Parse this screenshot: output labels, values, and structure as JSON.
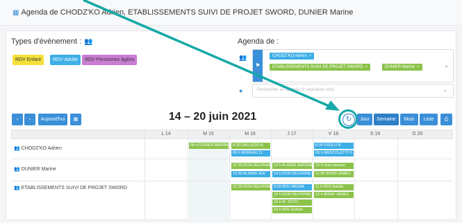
{
  "header": {
    "title": "Agenda de CHODZ'KO Adrien, ETABLISSEMENTS SUIVI DE PROJET SWORD, DUNIER Marine"
  },
  "types": {
    "label": "Types d'évènement :",
    "buttons": [
      {
        "label": "RDV Enfant",
        "color": "#f4e13a"
      },
      {
        "label": "RDV Adulte",
        "color": "#3eaee6"
      },
      {
        "label": "RDV Personnes âgées",
        "color": "#c97dd3"
      }
    ]
  },
  "agenda": {
    "label": "Agenda de :",
    "chips": [
      {
        "label": "CHODZ'KO Adrien",
        "color": "#3eaee6"
      },
      {
        "label": "ETABLISSEMENTS SUIVI DE PROJET SWORD",
        "color": "#8bc34a"
      },
      {
        "label": "DUNIER Marine",
        "color": "#8bc34a"
      }
    ],
    "search_placeholder": "Rechercher un agenda (3 caractères min)"
  },
  "toolbar": {
    "prev": "‹",
    "next": "›",
    "today": "Aujourd'hui",
    "range": "14 – 20 juin 2021",
    "views": [
      "Jour",
      "Semaine",
      "Mois",
      "Liste"
    ]
  },
  "days": [
    "L 14",
    "M 15",
    "M 16",
    "J 17",
    "V 18",
    "S 19",
    "D 20"
  ],
  "rows": [
    {
      "label": "CHODZ'KO Adrien"
    },
    {
      "label": "DUNIER Marine"
    },
    {
      "label": "ETABLISSEMENTS SUIVI DE PROJET SWORD"
    }
  ],
  "events": {
    "r1_m15_1": "09 h DUNIER MARINE",
    "r1_m16_1": "8:30 GALLEGO A.",
    "r1_m16_2": "09 h MOREAU D.",
    "r1_v18_1": "8:30 FROLU R.",
    "r1_v18_2": "09 h BROCOLETTI D.",
    "r2_m16_1": "12:30 DON DELPHINE",
    "r2_m16_2": "13:30 ALADIN JER",
    "r2_j17_1": "12 h ALADIN JEROME",
    "r2_j17_2": "14 h DON DELPHINE",
    "r2_v18_1": "10 h Suivi dossier",
    "r2_v18_2": "11:30 BOND JAMES",
    "r3_m16_1": "12:30 DON DELPHINE",
    "r3_j17_1": "9:30 RDV ABURA",
    "r3_j17_2": "10 h DON DELPHINE",
    "r3_j17_3": "10 h M. TOTO",
    "r3_j17_4": "10 h RDV Enfant",
    "r3_v18_1": "11 h RDV Adulte",
    "r3_v18_2": "12 h BOND JAMES"
  }
}
